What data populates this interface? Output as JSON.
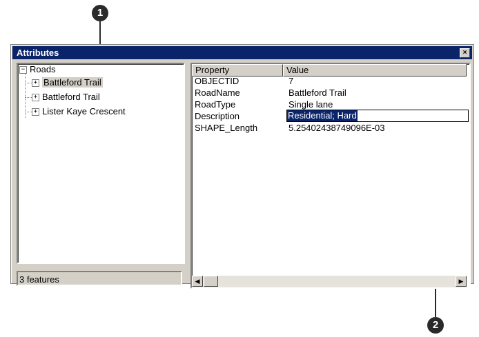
{
  "callouts": {
    "one": "1",
    "two": "2"
  },
  "window": {
    "title": "Attributes",
    "close_glyph": "×"
  },
  "tree": {
    "root": {
      "label": "Roads",
      "expander": "−"
    },
    "children": [
      {
        "label": "Battleford Trail",
        "expander": "+",
        "selected": true
      },
      {
        "label": "Battleford Trail",
        "expander": "+",
        "selected": false
      },
      {
        "label": "Lister Kaye Crescent",
        "expander": "+",
        "selected": false
      }
    ]
  },
  "status_bar": {
    "text": "3 features"
  },
  "grid": {
    "headers": {
      "property": "Property",
      "value": "Value"
    },
    "rows": [
      {
        "property": "OBJECTID",
        "value": "7"
      },
      {
        "property": "RoadName",
        "value": "Battleford Trail"
      },
      {
        "property": "RoadType",
        "value": "Single lane"
      },
      {
        "property": "Description",
        "value": "Residential; Hard",
        "editing": true
      },
      {
        "property": "SHAPE_Length",
        "value": "5.25402438749096E-03"
      }
    ]
  },
  "scrollbar": {
    "left_arrow": "◀",
    "right_arrow": "▶"
  },
  "colors": {
    "titlebar": "#0a246a",
    "chrome": "#d4d0c8",
    "highlight": "#0a246a"
  }
}
